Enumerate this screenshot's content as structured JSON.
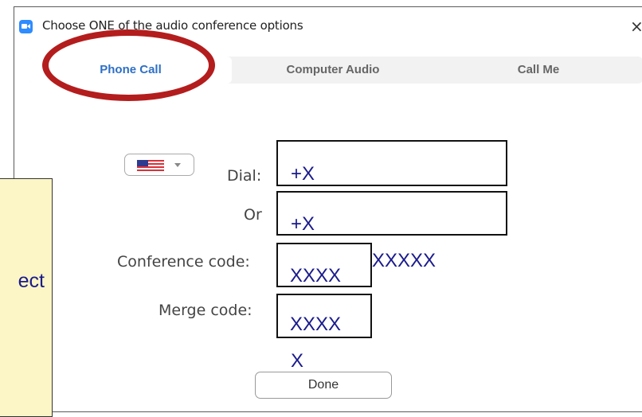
{
  "window": {
    "title": "Choose ONE of the audio conference options",
    "close_icon": "×"
  },
  "tabs": [
    {
      "label": "Phone Call",
      "active": true
    },
    {
      "label": "Computer Audio",
      "active": false
    },
    {
      "label": "Call Me",
      "active": false
    }
  ],
  "form": {
    "country_select": {
      "icon": "us-flag-icon"
    },
    "dial_label": "Dial:",
    "dial_value": "+X",
    "or_label": "Or",
    "or_value": "+X",
    "conference_label": "Conference code:",
    "conference_value": "XXXX",
    "conference_suffix": "XXXXX",
    "merge_label": "Merge code:",
    "merge_value": "XXXX",
    "merge_suffix": "X",
    "done_label": "Done"
  },
  "annotation": {
    "note_text": "ect",
    "highlight_color": "#b41d1d",
    "note_background": "#fcf6c6"
  },
  "colors": {
    "accent": "#2d6fc6",
    "overlay_text": "#1a1a8c"
  }
}
